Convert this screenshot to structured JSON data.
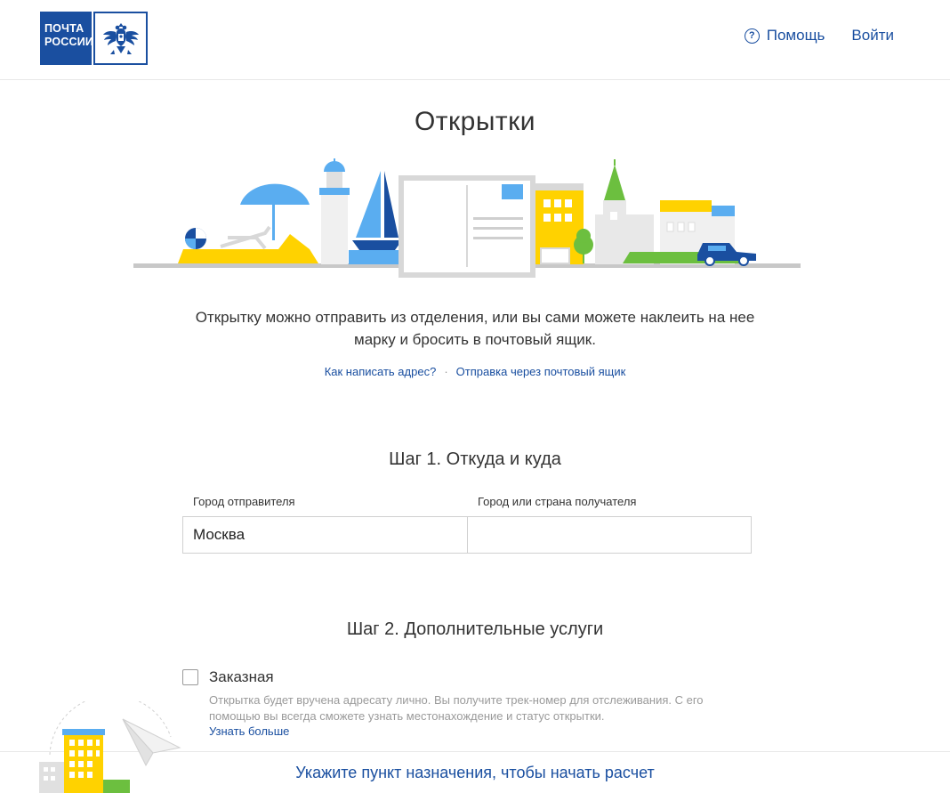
{
  "header": {
    "logo_line1": "ПОЧТА",
    "logo_line2": "РОССИИ",
    "help_icon": "question-circle-icon",
    "help_label": "Помощь",
    "login_label": "Войти"
  },
  "page": {
    "title": "Открытки",
    "intro_line1": "Открытку можно отправить из отделения, или вы сами можете наклеить на нее",
    "intro_line2": "марку и бросить в почтовый ящик.",
    "link_address": "Как написать адрес?",
    "link_separator": "·",
    "link_mailbox": "Отправка через почтовый ящик"
  },
  "step1": {
    "title": "Шаг 1. Откуда и куда",
    "from_label": "Город отправителя",
    "from_value": "Москва",
    "to_label": "Город или страна получателя",
    "to_value": ""
  },
  "step2": {
    "title": "Шаг 2. Дополнительные услуги",
    "registered_label": "Заказная",
    "registered_checked": false,
    "registered_desc_line1": "Открытка будет вручена адресату лично. Вы получите трек-номер для отслеживания. С его",
    "registered_desc_line2": "помощью вы всегда сможете узнать местонахождение и статус открытки.",
    "learn_more": "Узнать больше"
  },
  "footer": {
    "cta_text": "Укажите пункт назначения, чтобы начать расчет"
  },
  "colors": {
    "brand_blue": "#1a4fa0",
    "accent_yellow": "#ffd200",
    "accent_light_blue": "#5aadf0",
    "accent_green": "#6cbf3f"
  }
}
